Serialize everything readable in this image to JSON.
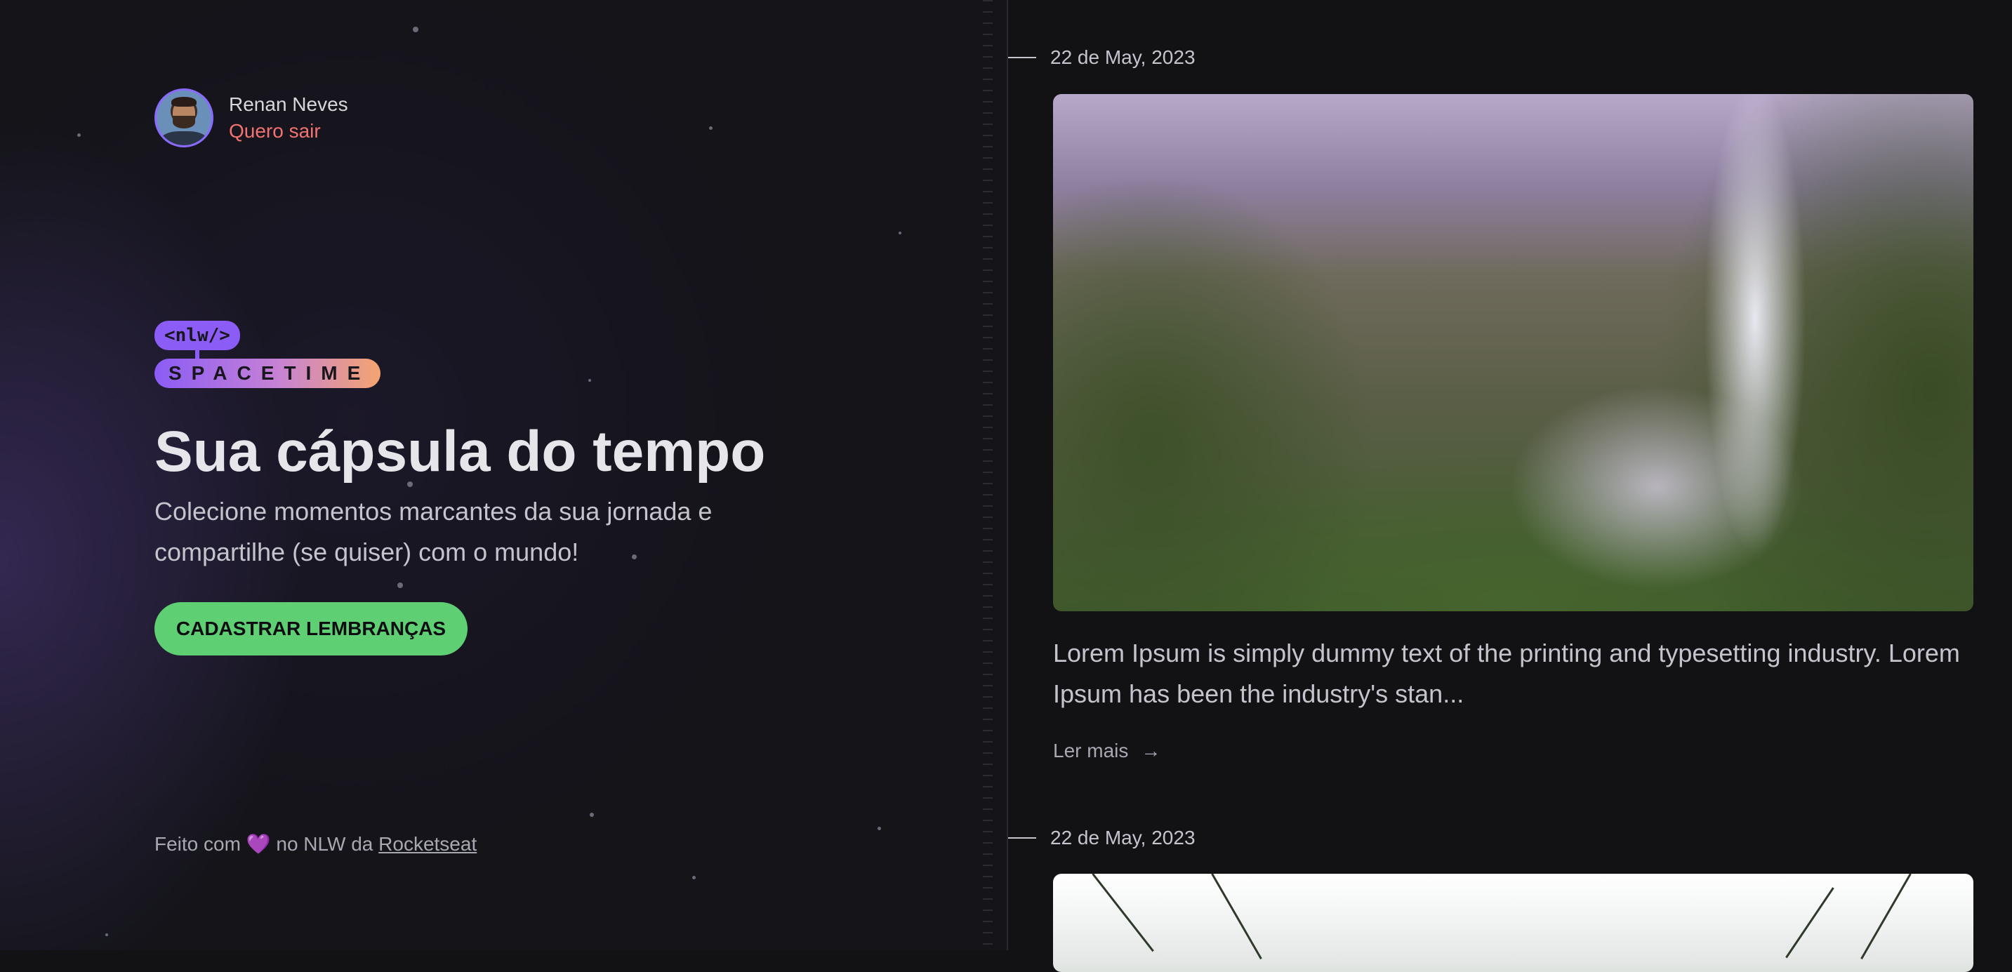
{
  "user": {
    "name": "Renan Neves",
    "logout_label": "Quero sair"
  },
  "logo": {
    "top_text": "<nlw/>",
    "bottom_text": "SPACETIME"
  },
  "hero": {
    "title": "Sua cápsula do tempo",
    "subtitle": "Colecione momentos marcantes da sua jornada e compartilhe (se quiser) com o mundo!",
    "cta_label": "CADASTRAR LEMBRANÇAS"
  },
  "footer": {
    "prefix": "Feito com",
    "heart": "💜",
    "middle": "no NLW da",
    "link_text": "Rocketseat"
  },
  "feed": {
    "entries": [
      {
        "date": "22 de May, 2023",
        "excerpt": "Lorem Ipsum is simply dummy text of the printing and typesetting industry. Lorem Ipsum has been the industry's stan...",
        "read_more": "Ler mais",
        "arrow": "→"
      },
      {
        "date": "22 de May, 2023"
      }
    ]
  },
  "colors": {
    "accent_purple": "#8b5cf6",
    "cta_green": "#5fcf74",
    "logout_red": "#f27171",
    "background": "#121215"
  }
}
